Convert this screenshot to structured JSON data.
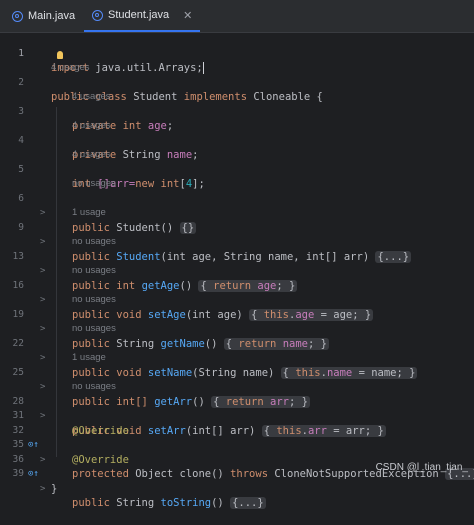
{
  "tabs": [
    {
      "label": "Main.java",
      "active": false
    },
    {
      "label": "Student.java",
      "active": true
    }
  ],
  "close_symbol": "✕",
  "colors": {
    "keyword": "#cf8e6d",
    "method": "#56a8f5",
    "field": "#c77dbb",
    "number": "#2aacb8",
    "annotation": "#b3ae60",
    "accent": "#3574f0"
  },
  "editor": {
    "line_numbers": [
      "1",
      "2",
      "3",
      "4",
      "5",
      "6",
      "9",
      "13",
      "16",
      "19",
      "22",
      "25",
      "28",
      "31",
      "32",
      "35",
      "36",
      "39"
    ],
    "hints": {
      "four_usages": "4 usages",
      "no_usages": "no usages",
      "one_usage": "1 usage"
    },
    "code": {
      "import": "import",
      "import_path": "java.util.Arrays;",
      "public": "public",
      "private": "private",
      "class": "class",
      "implements": "implements",
      "class_name": "Student",
      "cloneable": "Cloneable {",
      "int": "int",
      "string": "String",
      "age_field": "age",
      "name_field": "name",
      "arr_decl": "[]arr=",
      "new": "new",
      "arr_size": "4",
      "ctor_name": "Student",
      "fold_empty": "{}",
      "fold_dots": "{...}",
      "params_full": "(int age, String name, int[] arr)",
      "get_age": "getAge",
      "return": "return",
      "void": "void",
      "set_age": "setAge",
      "set_age_params": "(int age)",
      "this": "this",
      "get_name": "getName",
      "set_name": "setName",
      "set_name_params": "(String name)",
      "int_arr": "int[]",
      "get_arr": "getArr",
      "set_arr": "setArr",
      "set_arr_params": "(int[] arr)",
      "override": "@Override",
      "protected": "protected",
      "object": "Object",
      "clone": "clone()",
      "throws": "throws",
      "exception": "CloneNotSupportedException",
      "to_string": "toString",
      "closing_brace": "}"
    }
  },
  "watermark": "CSDN @l_tian_tian_"
}
